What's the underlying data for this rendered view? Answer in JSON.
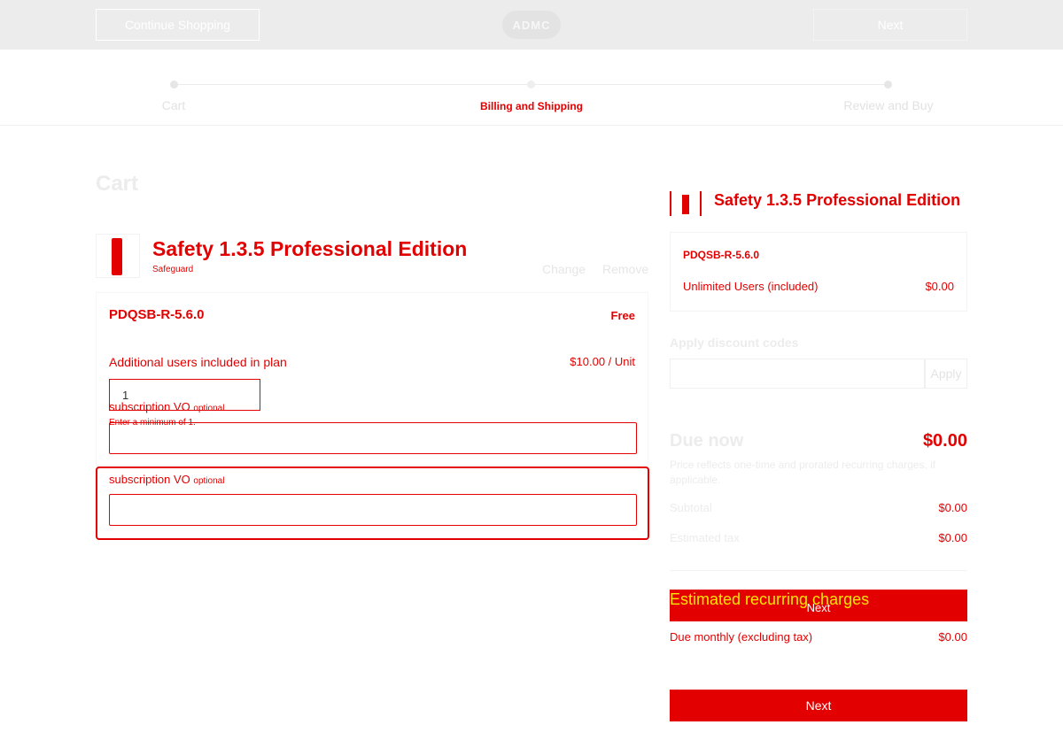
{
  "header": {
    "continue_label": "Continue Shopping",
    "logo_text": "ADMC",
    "next_label": "Next"
  },
  "stepper": {
    "steps": [
      {
        "label": "Cart",
        "state": "done"
      },
      {
        "label": "Billing and Shipping",
        "state": "active"
      },
      {
        "label": "Review and Buy",
        "state": "pending"
      }
    ]
  },
  "cart": {
    "title": "Cart",
    "product": {
      "name": "Safety 1.3.5 Professional Edition",
      "subtitle": "Safeguard",
      "change_label": "Change",
      "remove_label": "Remove"
    },
    "plan": {
      "name": "PDQSB-R-5.6.0",
      "price": "Free",
      "users_label": "Additional users included in plan",
      "users_price": "$10.00 / Unit",
      "quantity": "1",
      "hint": "Enter a minimum of 1."
    },
    "fields": [
      {
        "label": "subscription VO",
        "optional": "optional"
      },
      {
        "label": "subscription VO",
        "optional": "optional"
      }
    ]
  },
  "summary": {
    "product_name": "Safety 1.3.5 Professional Edition",
    "plan_name": "PDQSB-R-5.6.0",
    "users_label": "Unlimited Users (included)",
    "users_price": "$0.00",
    "discount_label": "Apply discount codes",
    "apply_label": "Apply",
    "due_now_label": "Due now",
    "due_now_value": "$0.00",
    "due_note": "Price reflects one-time and prorated recurring charges, if applicable.",
    "subtotal_label": "Subtotal",
    "subtotal_value": "$0.00",
    "tax_label": "Estimated tax",
    "tax_value": "$0.00",
    "recurring_title": "Estimated recurring charges",
    "recurring_next": "Next",
    "monthly_label": "Due monthly (excluding tax)",
    "monthly_value": "$0.00",
    "next_label": "Next"
  },
  "colors": {
    "accent": "#e30000",
    "highlight": "#ffe600"
  }
}
